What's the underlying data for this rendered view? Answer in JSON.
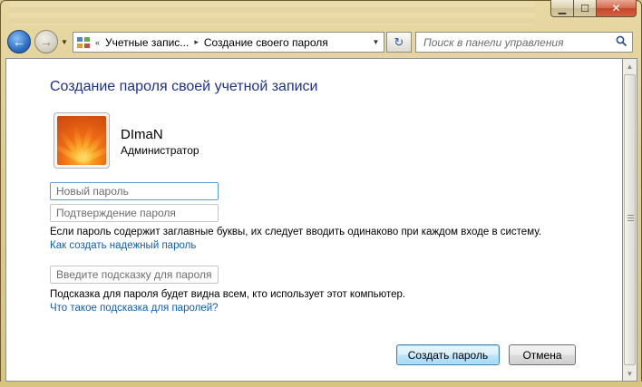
{
  "window": {
    "caption": {
      "minimize": "▁",
      "maximize": "☐",
      "close": "✕"
    }
  },
  "navbar": {
    "back_icon": "←",
    "forward_icon": "→",
    "history_icon": "▼",
    "breadcrumb": {
      "icon": "control-panel-icon",
      "prefix": "«",
      "items": [
        "Учетные запис...",
        "Создание своего пароля"
      ],
      "separator": "▸"
    },
    "refresh_icon": "↻",
    "search": {
      "placeholder": "Поиск в панели управления"
    }
  },
  "main": {
    "title": "Создание пароля своей учетной записи",
    "user": {
      "name": "DImaN",
      "role": "Администратор"
    },
    "fields": {
      "new_password": {
        "placeholder": "Новый пароль",
        "value": ""
      },
      "confirm_password": {
        "placeholder": "Подтверждение пароля",
        "value": ""
      },
      "hint": {
        "placeholder": "Введите подсказку для пароля",
        "value": ""
      }
    },
    "case_notice": "Если пароль содержит заглавные буквы, их следует вводить одинаково при каждом входе в систему.",
    "strong_password_link": "Как создать надежный пароль",
    "hint_notice": "Подсказка для пароля будет видна всем, кто использует этот компьютер.",
    "hint_help_link": "Что такое подсказка для паролей?",
    "buttons": {
      "create": "Создать пароль",
      "cancel": "Отмена"
    }
  },
  "colors": {
    "title": "#1e3287",
    "link": "#0b5fb5",
    "frame": "#e0cd90"
  }
}
